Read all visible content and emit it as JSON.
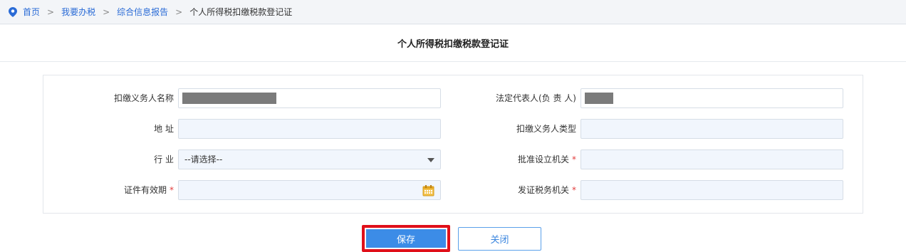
{
  "breadcrumb": {
    "items": [
      "首页",
      "我要办税",
      "综合信息报告"
    ],
    "separator": ">",
    "current": "个人所得税扣缴税款登记证"
  },
  "page": {
    "title": "个人所得税扣缴税款登记证"
  },
  "form": {
    "withholder_name_label": "扣缴义务人名称",
    "legal_rep_label": "法定代表人(负 责 人)",
    "address_label": "地 址",
    "withholder_type_label": "扣缴义务人类型",
    "industry_label": "行 业",
    "industry_value": "--请选择--",
    "approval_org_label": "批准设立机关",
    "validity_label": "证件有效期",
    "issuing_office_label": "发证税务机关",
    "required_mark": "*"
  },
  "buttons": {
    "save": "保存",
    "close": "关闭"
  },
  "colors": {
    "accent": "#3c8ce7",
    "highlight": "#e0101a",
    "link": "#2a6bd6",
    "required": "#e23b3b"
  }
}
